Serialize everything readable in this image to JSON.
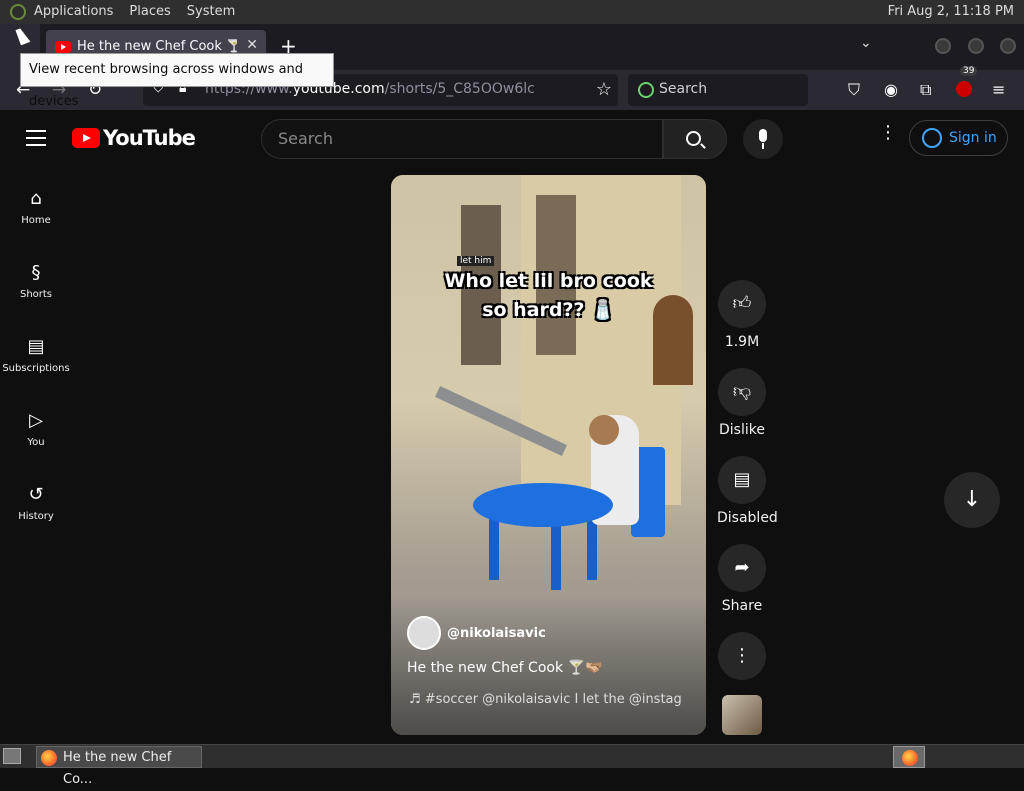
{
  "os_panel": {
    "menus": [
      "Applications",
      "Places",
      "System"
    ],
    "clock": "Fri Aug  2, 11:18 PM"
  },
  "browser": {
    "tab": {
      "title": "He the new Chef Cook 🍸🫱🏼‍🫲🏽"
    },
    "new_tab": "+",
    "tooltip": "View recent browsing across windows and devices",
    "url": {
      "scheme_host": "https://www.",
      "domain": "youtube.com",
      "path": "/shorts/5_C85OOw6lc"
    },
    "search_placeholder": "Search",
    "extension_badge": "39"
  },
  "youtube": {
    "logo_text": "YouTube",
    "search_placeholder": "Search",
    "sign_in": "Sign in",
    "sidebar": [
      {
        "label": "Home",
        "icon": "home-icon"
      },
      {
        "label": "Shorts",
        "icon": "shorts-icon"
      },
      {
        "label": "Subscriptions",
        "icon": "subscriptions-icon"
      },
      {
        "label": "You",
        "icon": "you-icon"
      },
      {
        "label": "History",
        "icon": "history-icon"
      }
    ],
    "short": {
      "caption_small": "let him",
      "caption_big": "Who let lil bro cook so hard?? 🧂",
      "channel": "@nikolaisavic",
      "title": "He the new Chef Cook 🍸🫱🏼‍🫲🏽",
      "music": "♬  #soccer  @nikolaisavic    I let the @instag"
    },
    "actions": {
      "like": "1.9M",
      "dislike": "Dislike",
      "comments": "Disabled",
      "share": "Share"
    }
  },
  "taskbar": {
    "window_title": "He the new Chef Co..."
  }
}
